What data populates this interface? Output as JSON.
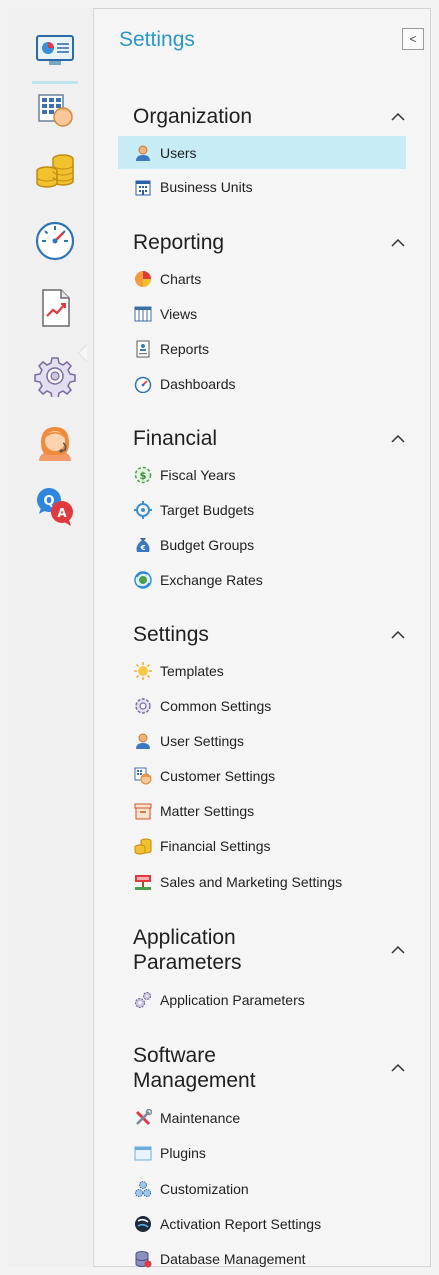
{
  "panel": {
    "title": "Settings",
    "collapse_glyph": "<"
  },
  "rail": [
    {
      "name": "dashboard-display-icon",
      "active": true
    },
    {
      "name": "customer-grid-icon"
    },
    {
      "name": "coins-icon"
    },
    {
      "name": "speedometer-icon"
    },
    {
      "name": "report-chart-icon"
    },
    {
      "name": "settings-gear-icon"
    },
    {
      "name": "support-agent-icon"
    },
    {
      "name": "qa-bubbles-icon"
    }
  ],
  "sections": [
    {
      "title": "Organization",
      "items": [
        {
          "label": "Users",
          "icon": "user-icon",
          "selected": true
        },
        {
          "label": "Business Units",
          "icon": "building-icon"
        }
      ]
    },
    {
      "title": "Reporting",
      "items": [
        {
          "label": "Charts",
          "icon": "pie-chart-icon"
        },
        {
          "label": "Views",
          "icon": "table-view-icon"
        },
        {
          "label": "Reports",
          "icon": "report-icon"
        },
        {
          "label": "Dashboards",
          "icon": "gauge-icon"
        }
      ]
    },
    {
      "title": "Financial",
      "items": [
        {
          "label": "Fiscal Years",
          "icon": "dollar-cycle-icon"
        },
        {
          "label": "Target Budgets",
          "icon": "target-icon"
        },
        {
          "label": "Budget Groups",
          "icon": "money-bag-icon"
        },
        {
          "label": "Exchange Rates",
          "icon": "exchange-icon"
        }
      ]
    },
    {
      "title": "Settings",
      "items": [
        {
          "label": "Templates",
          "icon": "sun-template-icon"
        },
        {
          "label": "Common Settings",
          "icon": "gear-icon"
        },
        {
          "label": "User Settings",
          "icon": "user-icon"
        },
        {
          "label": "Customer Settings",
          "icon": "customer-icon"
        },
        {
          "label": "Matter Settings",
          "icon": "box-icon"
        },
        {
          "label": "Financial Settings",
          "icon": "coins-icon"
        },
        {
          "label": "Sales and Marketing Settings",
          "icon": "sale-sign-icon"
        }
      ]
    },
    {
      "title": "Application Parameters",
      "items": [
        {
          "label": "Application Parameters",
          "icon": "gears-icon"
        }
      ]
    },
    {
      "title": "Software Management",
      "items": [
        {
          "label": "Maintenance",
          "icon": "tools-icon"
        },
        {
          "label": "Plugins",
          "icon": "plugin-window-icon"
        },
        {
          "label": "Customization",
          "icon": "customization-gears-icon"
        },
        {
          "label": "Activation Report Settings",
          "icon": "activation-icon"
        },
        {
          "label": "Database Management",
          "icon": "database-icon"
        }
      ]
    }
  ],
  "colors": {
    "accent": "#2a97c9",
    "selected_bg": "#c7ecf6"
  }
}
